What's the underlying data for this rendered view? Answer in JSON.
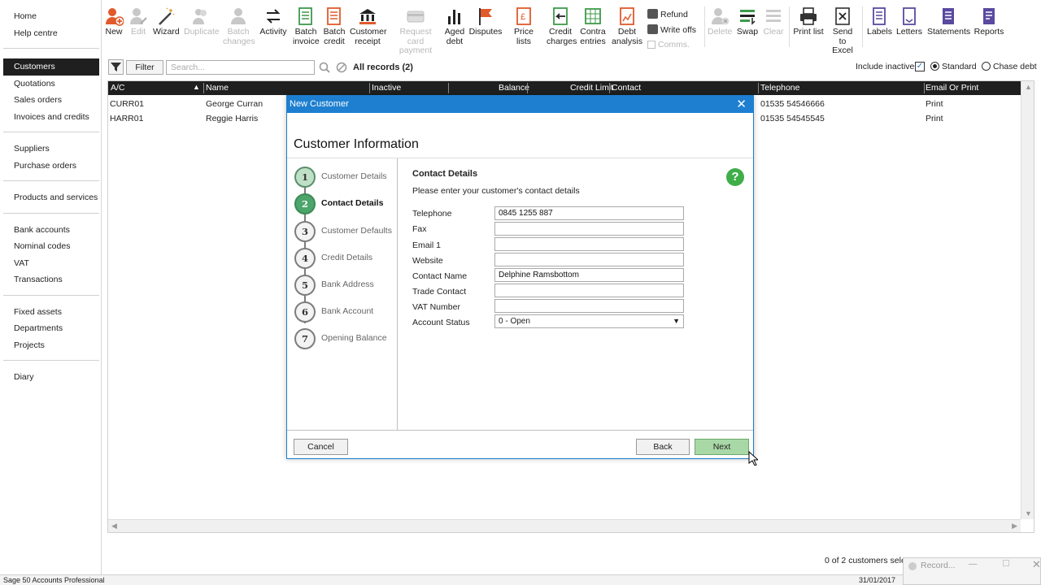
{
  "sidebar": {
    "groups": [
      [
        "Home",
        "Help centre"
      ],
      [
        "Customers",
        "Quotations",
        "Sales orders",
        "Invoices and credits"
      ],
      [
        "Suppliers",
        "Purchase orders"
      ],
      [
        "Products and services"
      ],
      [
        "Bank accounts",
        "Nominal codes",
        "VAT",
        "Transactions"
      ],
      [
        "Fixed assets",
        "Departments",
        "Projects"
      ],
      [
        "Diary"
      ]
    ],
    "active": "Customers"
  },
  "toolbar": {
    "new": "New",
    "edit": "Edit",
    "wizard": "Wizard",
    "duplicate": "Duplicate",
    "batch_changes_1": "Batch",
    "batch_changes_2": "changes",
    "activity": "Activity",
    "batch_invoice_1": "Batch",
    "batch_invoice_2": "invoice",
    "batch_credit_1": "Batch",
    "batch_credit_2": "credit",
    "customer_receipt_1": "Customer",
    "customer_receipt_2": "receipt",
    "request_card_1": "Request card",
    "request_card_2": "payment",
    "aged_debt_1": "Aged",
    "aged_debt_2": "debt",
    "disputes": "Disputes",
    "price_lists": "Price lists",
    "credit_charges_1": "Credit",
    "credit_charges_2": "charges",
    "contra_entries_1": "Contra",
    "contra_entries_2": "entries",
    "debt_analysis_1": "Debt",
    "debt_analysis_2": "analysis",
    "refund": "Refund",
    "write_offs": "Write offs",
    "comms": "Comms.",
    "delete": "Delete",
    "swap": "Swap",
    "clear": "Clear",
    "print_list": "Print list",
    "send_excel_1": "Send to",
    "send_excel_2": "Excel",
    "labels": "Labels",
    "letters": "Letters",
    "statements": "Statements",
    "reports": "Reports"
  },
  "filterbar": {
    "filter_label": "Filter",
    "search_placeholder": "Search...",
    "records": "All records (2)",
    "include_inactive": "Include inactive",
    "standard": "Standard",
    "chase_debt": "Chase debt"
  },
  "grid": {
    "columns": [
      "A/C",
      "Name",
      "Inactive",
      "Balance",
      "Credit Limit",
      "Contact",
      "Telephone",
      "Email Or Print"
    ],
    "rows": [
      {
        "ac": "CURR01",
        "name": "George Curran",
        "telephone": "01535 54546666",
        "email_print": "Print"
      },
      {
        "ac": "HARR01",
        "name": "Reggie Harris",
        "telephone": "01535 54545545",
        "email_print": "Print"
      }
    ]
  },
  "status": {
    "app": "Sage 50 Accounts Professional",
    "date": "31/01/2017",
    "count": "0 of 2 customers selec",
    "recorder": "Record..."
  },
  "modal": {
    "title": "New Customer",
    "heading": "Customer Information",
    "steps": [
      {
        "num": "1",
        "label": "Customer Details",
        "state": "done"
      },
      {
        "num": "2",
        "label": "Contact Details",
        "state": "current"
      },
      {
        "num": "3",
        "label": "Customer Defaults",
        "state": "todo"
      },
      {
        "num": "4",
        "label": "Credit Details",
        "state": "todo"
      },
      {
        "num": "5",
        "label": "Bank Address",
        "state": "todo"
      },
      {
        "num": "6",
        "label": "Bank Account",
        "state": "todo"
      },
      {
        "num": "7",
        "label": "Opening Balance",
        "state": "todo"
      }
    ],
    "section_title": "Contact Details",
    "section_desc": "Please enter your customer's contact details",
    "fields": {
      "telephone": {
        "label": "Telephone",
        "value": "0845 1255 887"
      },
      "fax": {
        "label": "Fax",
        "value": ""
      },
      "email1": {
        "label": "Email 1",
        "value": ""
      },
      "website": {
        "label": "Website",
        "value": ""
      },
      "contact_name": {
        "label": "Contact Name",
        "value": "Delphine Ramsbottom"
      },
      "trade_contact": {
        "label": "Trade Contact",
        "value": ""
      },
      "vat_number": {
        "label": "VAT Number",
        "value": ""
      },
      "account_status": {
        "label": "Account Status",
        "value": "0 - Open"
      }
    },
    "cancel": "Cancel",
    "back": "Back",
    "next": "Next",
    "help_glyph": "?"
  },
  "colors": {
    "accent_blue": "#1e7fd0",
    "header_dark": "#1f1f1f",
    "step_green": "#4ca56a",
    "next_green": "#a9d8a7",
    "toolbar_red": "#e05a2b",
    "toolbar_green": "#3d9a4a",
    "toolbar_purple": "#5a4aa0"
  }
}
